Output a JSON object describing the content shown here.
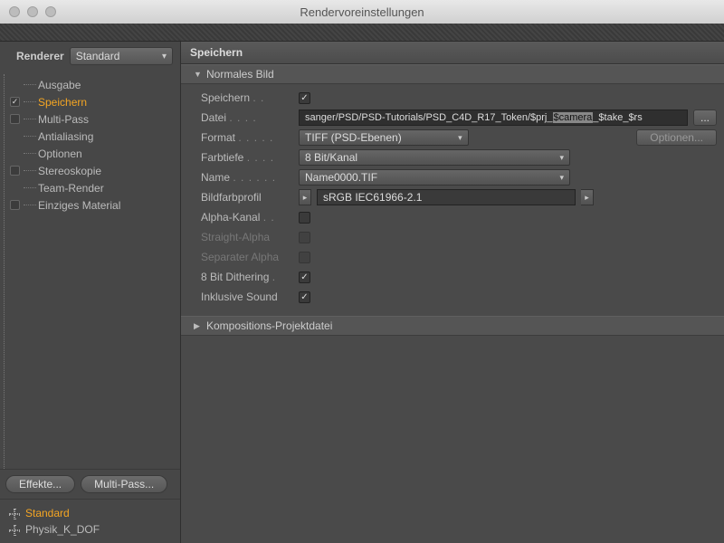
{
  "window": {
    "title": "Rendervoreinstellungen"
  },
  "renderer": {
    "label": "Renderer",
    "value": "Standard"
  },
  "nav": {
    "items": [
      {
        "label": "Ausgabe",
        "checkbox": false,
        "checked": false,
        "selected": false
      },
      {
        "label": "Speichern",
        "checkbox": true,
        "checked": true,
        "selected": true
      },
      {
        "label": "Multi-Pass",
        "checkbox": true,
        "checked": false,
        "selected": false
      },
      {
        "label": "Antialiasing",
        "checkbox": false,
        "checked": false,
        "selected": false
      },
      {
        "label": "Optionen",
        "checkbox": false,
        "checked": false,
        "selected": false
      },
      {
        "label": "Stereoskopie",
        "checkbox": true,
        "checked": false,
        "selected": false
      },
      {
        "label": "Team-Render",
        "checkbox": false,
        "checked": false,
        "selected": false
      },
      {
        "label": "Einziges Material",
        "checkbox": true,
        "checked": false,
        "selected": false
      }
    ]
  },
  "buttons": {
    "effects": "Effekte...",
    "multipass": "Multi-Pass..."
  },
  "presets": [
    {
      "label": "Standard",
      "selected": true
    },
    {
      "label": "Physik_K_DOF",
      "selected": false
    }
  ],
  "panel": {
    "title": "Speichern",
    "section1": "Normales Bild",
    "section2": "Kompositions-Projektdatei",
    "save": {
      "label": "Speichern",
      "checked": true
    },
    "file": {
      "label": "Datei",
      "prefix": "sanger/PSD/PSD-Tutorials/PSD_C4D_R17_Token/$prj_",
      "highlight": "$camera",
      "suffix": "_$take_$rs",
      "more": "..."
    },
    "format": {
      "label": "Format",
      "value": "TIFF (PSD-Ebenen)",
      "options": "Optionen..."
    },
    "depth": {
      "label": "Farbtiefe",
      "value": "8 Bit/Kanal"
    },
    "name": {
      "label": "Name",
      "value": "Name0000.TIF"
    },
    "colorprofile": {
      "label": "Bildfarbprofil",
      "value": "sRGB IEC61966-2.1"
    },
    "alpha": {
      "label": "Alpha-Kanal",
      "checked": false
    },
    "straight": {
      "label": "Straight-Alpha",
      "checked": false
    },
    "separate": {
      "label": "Separater Alpha",
      "checked": false
    },
    "dither": {
      "label": "8 Bit Dithering",
      "checked": true
    },
    "sound": {
      "label": "Inklusive Sound",
      "checked": true
    }
  }
}
